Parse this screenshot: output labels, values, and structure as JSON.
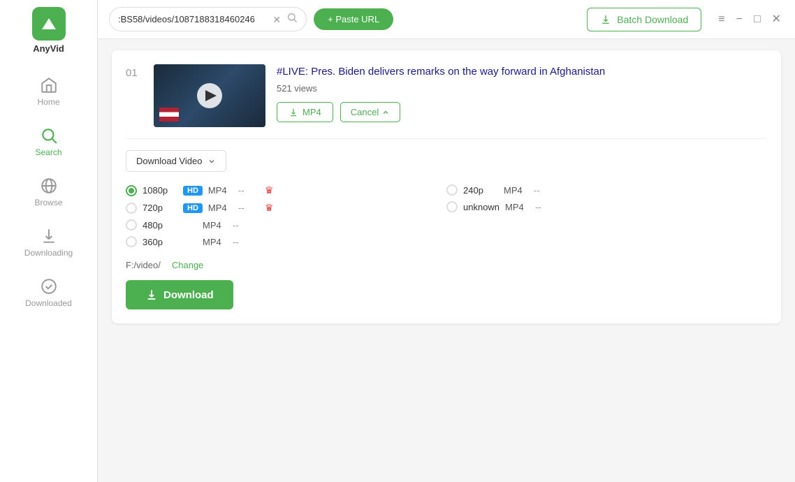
{
  "app": {
    "name": "AnyVid",
    "logo_alt": "AnyVid logo"
  },
  "titlebar": {
    "url_value": ":BS58/videos/1087188318460246",
    "paste_url_label": "+ Paste URL",
    "window_controls": [
      "menu",
      "minimize",
      "maximize",
      "close"
    ]
  },
  "batch_download": {
    "label": "Batch Download",
    "icon": "download-icon"
  },
  "sidebar": {
    "items": [
      {
        "id": "home",
        "label": "Home",
        "active": false
      },
      {
        "id": "search",
        "label": "Search",
        "active": true
      },
      {
        "id": "browse",
        "label": "Browse",
        "active": false
      },
      {
        "id": "downloading",
        "label": "Downloading",
        "active": false
      },
      {
        "id": "downloaded",
        "label": "Downloaded",
        "active": false
      }
    ]
  },
  "video": {
    "number": "01",
    "title": "#LIVE: Pres. Biden delivers remarks on the way forward in Afghanistan",
    "views": "521 views",
    "mp4_button": "MP4",
    "cancel_button": "Cancel"
  },
  "download_options": {
    "dropdown_label": "Download Video",
    "qualities": [
      {
        "id": "1080p",
        "label": "1080p",
        "hd": true,
        "format": "MP4",
        "size": "--",
        "premium": true,
        "selected": true
      },
      {
        "id": "720p",
        "label": "720p",
        "hd": true,
        "format": "MP4",
        "size": "--",
        "premium": true,
        "selected": false
      },
      {
        "id": "480p",
        "label": "480p",
        "hd": false,
        "format": "MP4",
        "size": "--",
        "premium": false,
        "selected": false
      },
      {
        "id": "360p",
        "label": "360p",
        "hd": false,
        "format": "MP4",
        "size": "--",
        "premium": false,
        "selected": false
      },
      {
        "id": "240p",
        "label": "240p",
        "hd": false,
        "format": "MP4",
        "size": "--",
        "premium": false,
        "selected": false
      },
      {
        "id": "unknown",
        "label": "unknown",
        "hd": false,
        "format": "MP4",
        "size": "--",
        "premium": false,
        "selected": false
      }
    ],
    "save_path": "F:/video/",
    "change_label": "Change",
    "download_button": "Download"
  }
}
